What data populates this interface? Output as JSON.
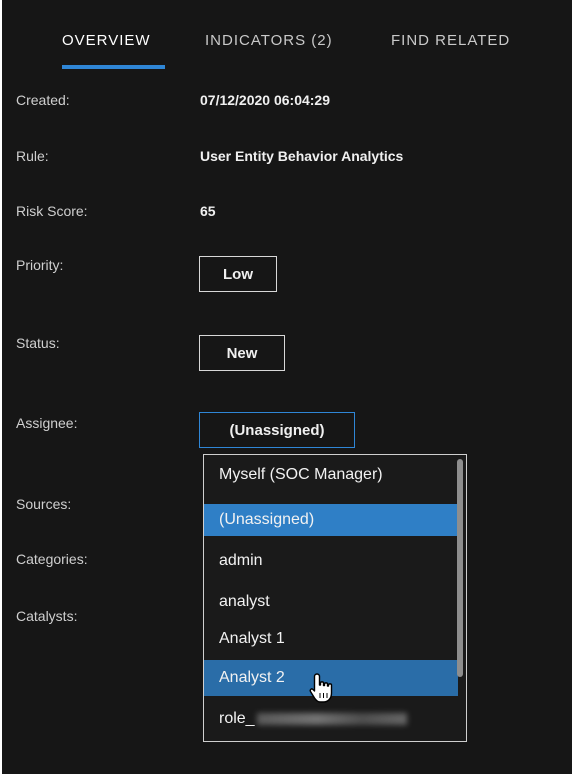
{
  "tabs": [
    {
      "label": "OVERVIEW",
      "active": true
    },
    {
      "label": "INDICATORS (2)",
      "active": false
    },
    {
      "label": "FIND RELATED",
      "active": false
    }
  ],
  "details": {
    "created_label": "Created:",
    "created_value": "07/12/2020 06:04:29",
    "rule_label": "Rule:",
    "rule_value": "User Entity Behavior Analytics",
    "risk_label": "Risk Score:",
    "risk_value": "65",
    "priority_label": "Priority:",
    "priority_value": "Low",
    "status_label": "Status:",
    "status_value": "New",
    "assignee_label": "Assignee:",
    "assignee_value": "(Unassigned)",
    "sources_label": "Sources:",
    "categories_label": "Categories:",
    "catalysts_label": "Catalysts:"
  },
  "assignee_dropdown": {
    "options": [
      "Myself (SOC Manager)",
      "(Unassigned)",
      "admin",
      "analyst",
      "Analyst 1",
      "Analyst 2",
      "role_"
    ],
    "selected": "(Unassigned)",
    "hovered": "Analyst 2"
  },
  "colors": {
    "background": "#161616",
    "accent": "#2f86d6",
    "selected_option": "#2f7fc6",
    "hovered_option": "#2a6da8"
  }
}
